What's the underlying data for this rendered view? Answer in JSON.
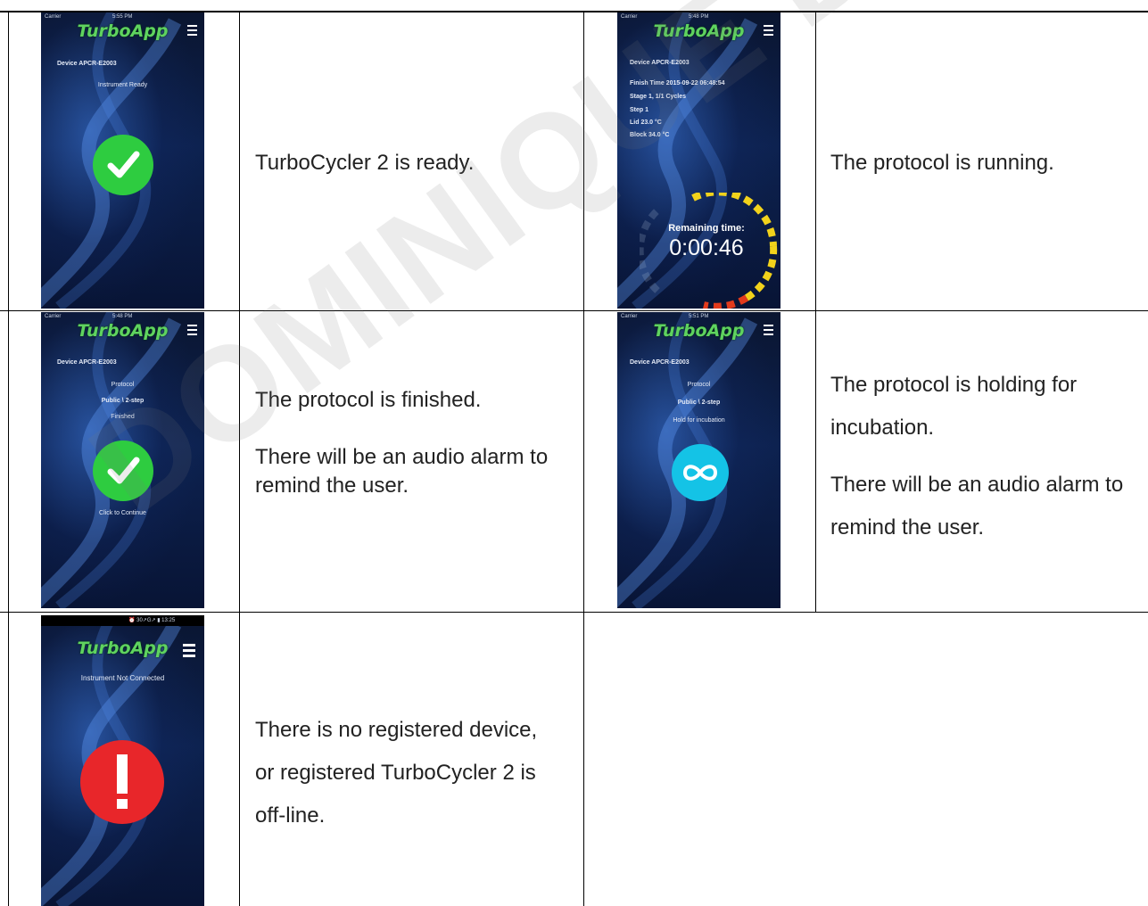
{
  "app": {
    "name": "TurboApp"
  },
  "watermark": "DOMINIQUE DUTSCHER",
  "rows": [
    {
      "left": {
        "screen": {
          "status_time": "5:55 PM",
          "status_carrier": "Carrier",
          "device_label": "Device  APCR-E2003",
          "status_text": "Instrument Ready"
        },
        "description": [
          "TurboCycler 2 is ready."
        ]
      },
      "right": {
        "screen": {
          "status_time": "5:48 PM",
          "status_carrier": "Carrier",
          "device_label": "Device  APCR-E2003",
          "finish_time": "Finish Time  2015-09-22 06:48:54",
          "stage": "Stage  1, 1/1 Cycles",
          "step": "Step  1",
          "lid": "Lid    23.0 °C",
          "block": "Block  34.0 °C",
          "remaining_label": "Remaining time:",
          "remaining_value": "0:00:46"
        },
        "description": [
          "The protocol is running."
        ]
      }
    },
    {
      "left": {
        "screen": {
          "status_time": "5:48 PM",
          "status_carrier": "Carrier",
          "device_label": "Device  APCR-E2003",
          "protocol_label": "Protocol",
          "protocol_name": "Public \\ 2-step",
          "status_text": "Finished",
          "continue_text": "Click to Continue"
        },
        "description": [
          "The protocol is finished.",
          "There will be an audio alarm to remind the user."
        ]
      },
      "right": {
        "screen": {
          "status_time": "5:51 PM",
          "status_carrier": "Carrier",
          "device_label": "Device  APCR-E2003",
          "protocol_label": "Protocol",
          "protocol_name": "Public \\ 2-step",
          "status_text": "Hold for incubation"
        },
        "description": [
          "The protocol is holding for incubation.",
          "There will be an audio alarm to remind the user."
        ]
      }
    },
    {
      "left": {
        "screen": {
          "status_time": "⏰ 30↗G↗ ▮ 13:25",
          "status_text": "Instrument Not Connected"
        },
        "description": [
          "There is no registered device, or registered TurboCycler 2 is off-line."
        ]
      }
    }
  ],
  "colors": {
    "ready_green": "#2ecc40",
    "hold_cyan": "#14c3e6",
    "error_red": "#e8262a",
    "title_green": "#5fd35f",
    "timer_yellow": "#f2d21b",
    "timer_red": "#e23a1c"
  },
  "icons": {
    "ready": "check-icon",
    "running": "countdown-ring-icon",
    "finished": "check-icon",
    "hold": "infinity-icon",
    "offline": "exclamation-icon",
    "menu": "hamburger-menu-icon"
  }
}
